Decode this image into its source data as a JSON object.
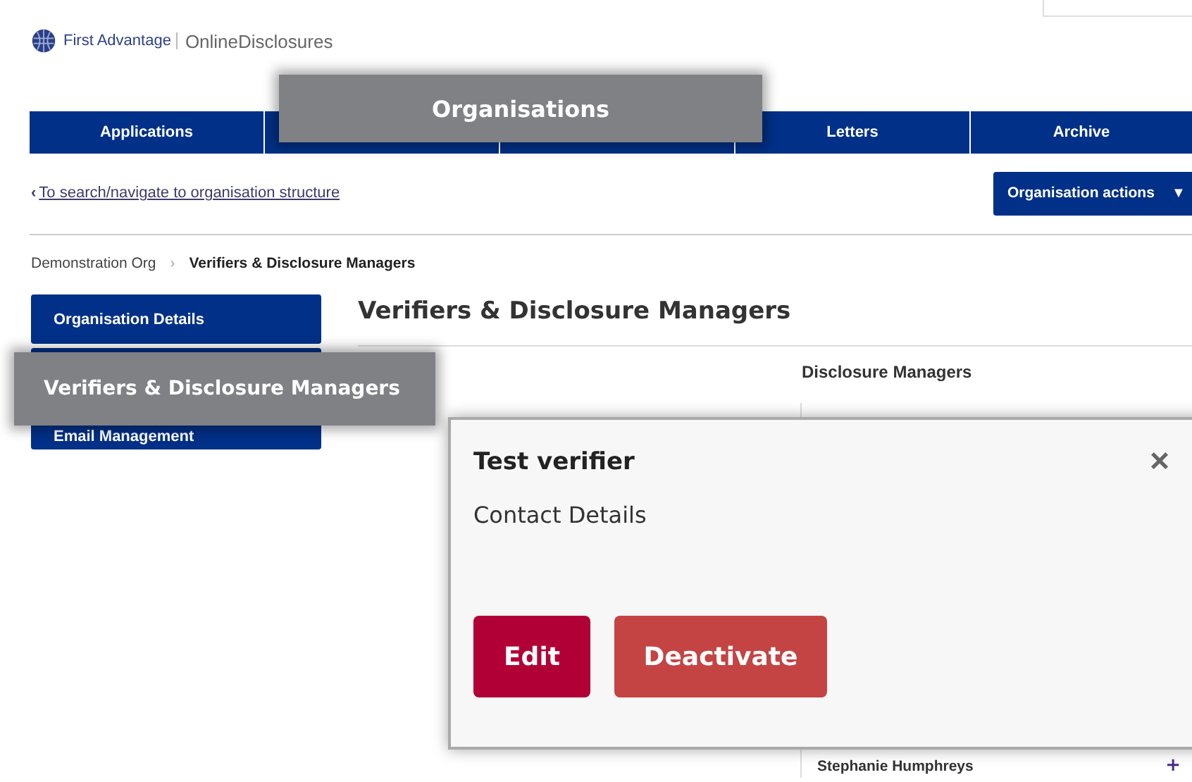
{
  "logo": {
    "brand": "First Advantage",
    "product": "OnlineDisclosures"
  },
  "nav_tabs": [
    {
      "kind": "labeled",
      "label": "Applications"
    },
    {
      "kind": "covered"
    },
    {
      "kind": "covered"
    },
    {
      "kind": "labeled",
      "label": "Letters"
    },
    {
      "kind": "labeled",
      "label": "Archive"
    }
  ],
  "back_link": "To search/navigate to organisation structure",
  "back_icon": "‹",
  "actions_button": {
    "label": "Organisation actions",
    "caret": "▼"
  },
  "breadcrumb": [
    {
      "label": "Demonstration Org",
      "current": false
    },
    {
      "label": "Verifiers & Disclosure Managers",
      "current": true
    }
  ],
  "breadcrumb_separator": "›",
  "sidebar": {
    "items": [
      {
        "kind": "labeled",
        "label": "Organisation Details"
      },
      {
        "kind": "covered"
      },
      {
        "kind": "labeled",
        "label": "Email Management"
      }
    ]
  },
  "heading": "Verifiers & Disclosure Managers",
  "column_title": "Disclosure Managers",
  "managers": [
    {
      "name": "Stephanie Humphreys",
      "icon": "+"
    }
  ],
  "modal": {
    "title": "Test verifier",
    "close": "×",
    "section": "Contact Details",
    "buttons": [
      {
        "label": "Edit",
        "kind": "primary"
      },
      {
        "label": "Deactivate",
        "kind": "danger"
      }
    ]
  },
  "callouts": [
    {
      "label": "Organisations",
      "kind": "tab"
    },
    {
      "label": "Verifiers & Disclosure Managers",
      "kind": "sidebar"
    }
  ]
}
